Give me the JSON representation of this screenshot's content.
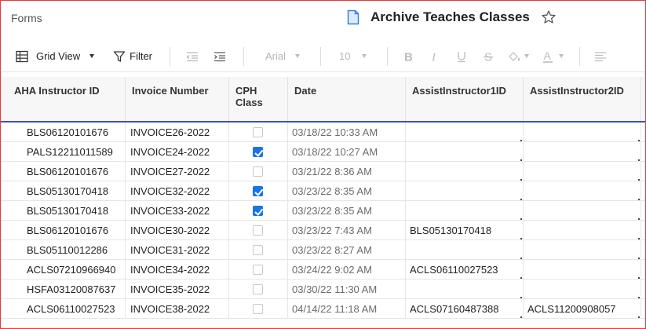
{
  "header": {
    "forms_link": "Forms",
    "sheet_title": "Archive Teaches Classes"
  },
  "toolbar": {
    "view_label": "Grid View",
    "filter_label": "Filter",
    "font_family": "Arial",
    "font_size": "10"
  },
  "grid": {
    "columns": [
      {
        "label": "AHA Instructor ID"
      },
      {
        "label": "Invoice Number"
      },
      {
        "label": "CPH Class"
      },
      {
        "label": "Date"
      },
      {
        "label": "AssistInstructor1ID"
      },
      {
        "label": "AssistInstructor2ID"
      }
    ],
    "rows": [
      {
        "aha_id": "BLS06120101676",
        "invoice": "INVOICE26-2022",
        "cph": false,
        "date": "03/18/22 10:33 AM",
        "assist1": "",
        "assist2": ""
      },
      {
        "aha_id": "PALS12211011589",
        "invoice": "INVOICE24-2022",
        "cph": true,
        "date": "03/18/22 10:27 AM",
        "assist1": "",
        "assist2": ""
      },
      {
        "aha_id": "BLS06120101676",
        "invoice": "INVOICE27-2022",
        "cph": false,
        "date": "03/21/22 8:36 AM",
        "assist1": "",
        "assist2": ""
      },
      {
        "aha_id": "BLS05130170418",
        "invoice": "INVOICE32-2022",
        "cph": true,
        "date": "03/23/22 8:35 AM",
        "assist1": "",
        "assist2": ""
      },
      {
        "aha_id": "BLS05130170418",
        "invoice": "INVOICE33-2022",
        "cph": true,
        "date": "03/23/22 8:35 AM",
        "assist1": "",
        "assist2": ""
      },
      {
        "aha_id": "BLS06120101676",
        "invoice": "INVOICE30-2022",
        "cph": false,
        "date": "03/23/22 7:43 AM",
        "assist1": "BLS05130170418",
        "assist2": ""
      },
      {
        "aha_id": "BLS05110012286",
        "invoice": "INVOICE31-2022",
        "cph": false,
        "date": "03/23/22 8:27 AM",
        "assist1": "",
        "assist2": ""
      },
      {
        "aha_id": "ACLS07210966940",
        "invoice": "INVOICE34-2022",
        "cph": false,
        "date": "03/24/22 9:02 AM",
        "assist1": "ACLS06110027523",
        "assist2": ""
      },
      {
        "aha_id": "HSFA03120087637",
        "invoice": "INVOICE35-2022",
        "cph": false,
        "date": "03/30/22 11:30 AM",
        "assist1": "",
        "assist2": ""
      },
      {
        "aha_id": "ACLS06110027523",
        "invoice": "INVOICE38-2022",
        "cph": false,
        "date": "04/14/22 11:18 AM",
        "assist1": "ACLS07160487388",
        "assist2": "ACLS11200908057"
      }
    ]
  }
}
